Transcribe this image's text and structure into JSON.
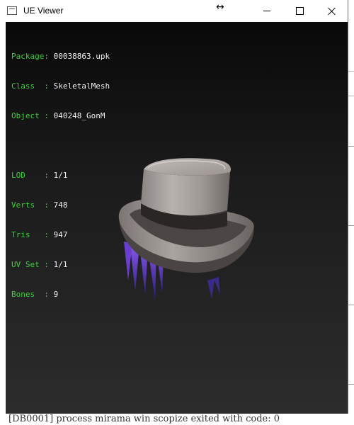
{
  "window": {
    "title": "UE Viewer",
    "controls": {
      "resize_glyph": "↔",
      "minimize": "minimize",
      "maximize": "maximize",
      "close": "close"
    }
  },
  "info": {
    "package_label": "Package: ",
    "package_value": "00038863.upk",
    "class_label": "Class  : ",
    "class_value": "SkeletalMesh",
    "object_label": "Object : ",
    "object_value": "040248_GonM",
    "lod_label": "LOD    : ",
    "lod_value": "1/1",
    "verts_label": "Verts  : ",
    "verts_value": "748",
    "tris_label": "Tris   : ",
    "tris_value": "947",
    "uvset_label": "UV Set : ",
    "uvset_value": "1/1",
    "bones_label": "Bones  : ",
    "bones_value": "9"
  },
  "colors": {
    "label_green": "#3ad03a",
    "value_white": "#f0f0f0",
    "viewport_top": "#090909",
    "viewport_bottom": "#2c2c2c"
  },
  "background": {
    "console_text": "[DB0001] process  mirama win scopize  exited with code: 0"
  }
}
